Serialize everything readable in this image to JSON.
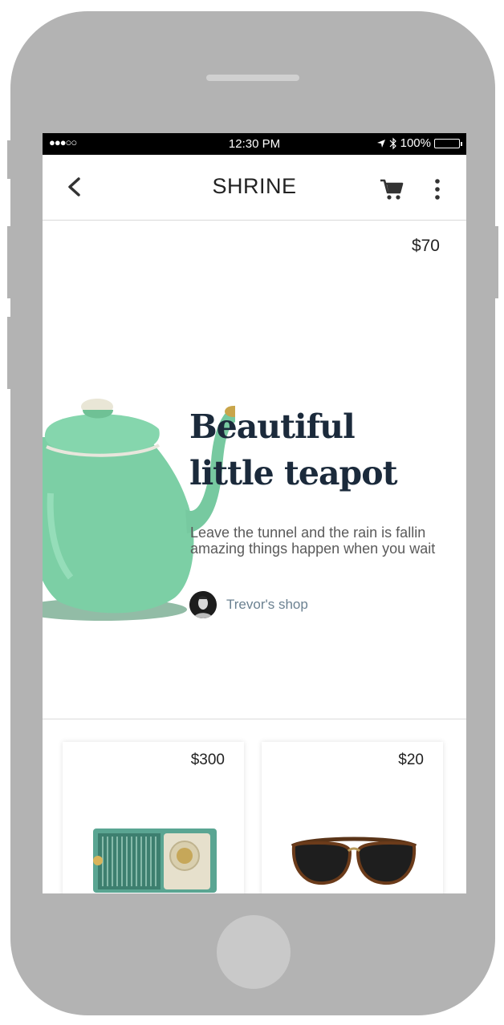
{
  "status_bar": {
    "signal": "●●●○○",
    "time": "12:30 PM",
    "battery": "100%"
  },
  "app_bar": {
    "title": "SHRINE"
  },
  "hero": {
    "price": "$70",
    "title_line1": "Beautiful",
    "title_line2": "little teapot",
    "description": "Leave the tunnel and the rain is fallin amazing things happen when you wait",
    "shop": "Trevor's shop"
  },
  "products": [
    {
      "price": "$300"
    },
    {
      "price": "$20"
    }
  ],
  "colors": {
    "title": "#1b2a3b",
    "shop": "#6b8191",
    "teapot": "#7ccfa5",
    "frame": "#b3b3b3"
  }
}
